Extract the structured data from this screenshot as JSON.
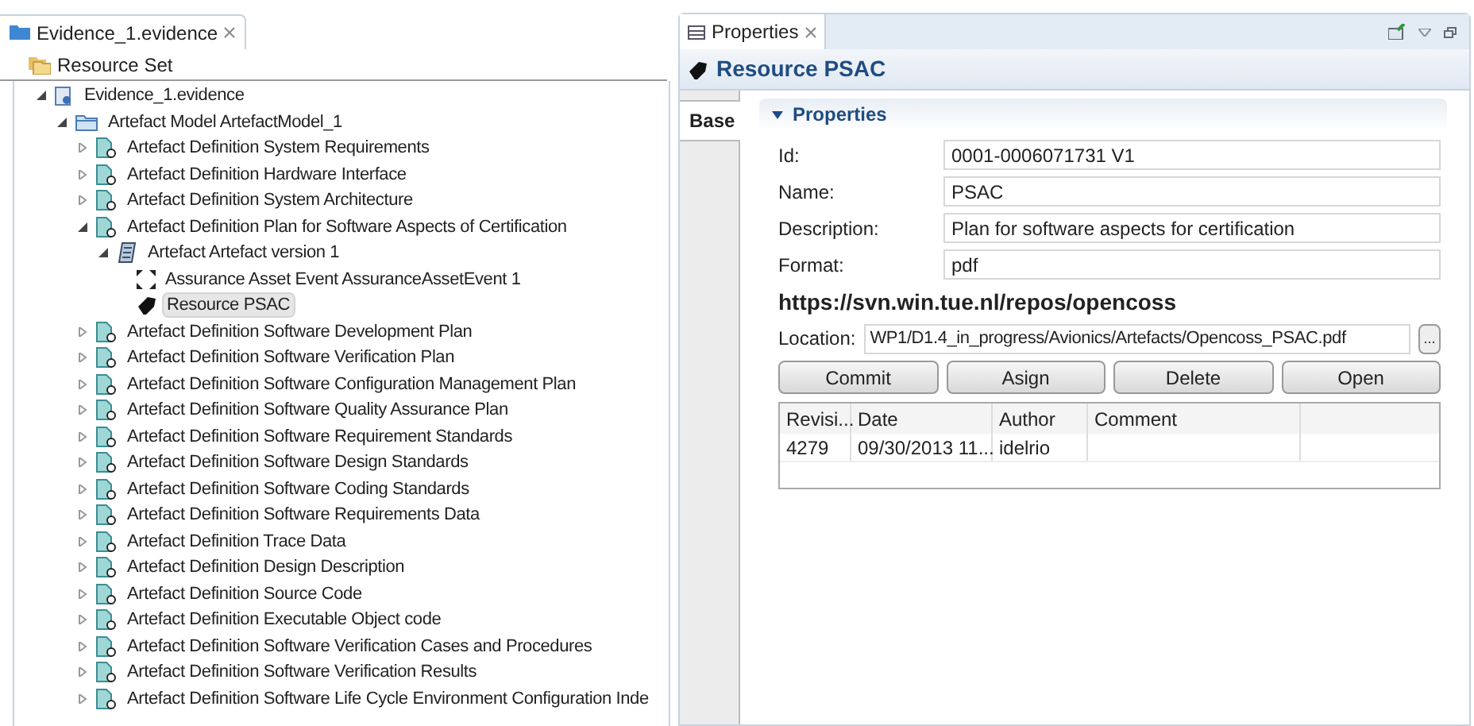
{
  "editor": {
    "tab_title": "Evidence_1.evidence",
    "root_label": "Resource Set"
  },
  "tree": [
    {
      "kind": "file",
      "label": "Evidence_1.evidence",
      "expanded": true,
      "selected": false,
      "children": [
        {
          "kind": "model",
          "label": "Artefact Model ArtefactModel_1",
          "expanded": true,
          "selected": false,
          "children": [
            {
              "kind": "definition",
              "label": "Artefact Definition System Requirements",
              "expanded": false,
              "selected": false
            },
            {
              "kind": "definition",
              "label": "Artefact Definition Hardware Interface",
              "expanded": false,
              "selected": false
            },
            {
              "kind": "definition",
              "label": "Artefact Definition System Architecture",
              "expanded": false,
              "selected": false
            },
            {
              "kind": "definition",
              "label": "Artefact Definition Plan for Software Aspects of Certification",
              "expanded": true,
              "selected": false,
              "children": [
                {
                  "kind": "artefact",
                  "label": "Artefact Artefact version 1",
                  "expanded": true,
                  "selected": false,
                  "children": [
                    {
                      "kind": "event",
                      "label": "Assurance Asset Event AssuranceAssetEvent 1",
                      "selected": false
                    },
                    {
                      "kind": "resource",
                      "label": "Resource PSAC",
                      "selected": true
                    }
                  ]
                }
              ]
            },
            {
              "kind": "definition",
              "label": "Artefact Definition Software Development Plan",
              "expanded": false,
              "selected": false
            },
            {
              "kind": "definition",
              "label": "Artefact Definition Software Verification Plan",
              "expanded": false,
              "selected": false
            },
            {
              "kind": "definition",
              "label": "Artefact Definition Software Configuration Management Plan",
              "expanded": false,
              "selected": false
            },
            {
              "kind": "definition",
              "label": "Artefact Definition Software Quality Assurance Plan",
              "expanded": false,
              "selected": false
            },
            {
              "kind": "definition",
              "label": "Artefact Definition Software Requirement Standards",
              "expanded": false,
              "selected": false
            },
            {
              "kind": "definition",
              "label": "Artefact Definition Software Design Standards",
              "expanded": false,
              "selected": false
            },
            {
              "kind": "definition",
              "label": "Artefact Definition Software Coding Standards",
              "expanded": false,
              "selected": false
            },
            {
              "kind": "definition",
              "label": "Artefact Definition Software Requirements Data",
              "expanded": false,
              "selected": false
            },
            {
              "kind": "definition",
              "label": "Artefact Definition Trace Data",
              "expanded": false,
              "selected": false
            },
            {
              "kind": "definition",
              "label": "Artefact Definition Design Description",
              "expanded": false,
              "selected": false
            },
            {
              "kind": "definition",
              "label": "Artefact Definition Source Code",
              "expanded": false,
              "selected": false
            },
            {
              "kind": "definition",
              "label": "Artefact Definition Executable Object code",
              "expanded": false,
              "selected": false
            },
            {
              "kind": "definition",
              "label": "Artefact Definition Software Verification Cases and Procedures",
              "expanded": false,
              "selected": false
            },
            {
              "kind": "definition",
              "label": "Artefact Definition Software Verification Results",
              "expanded": false,
              "selected": false
            },
            {
              "kind": "definition",
              "label": "Artefact Definition Software Life Cycle Environment Configuration Inde",
              "expanded": false,
              "selected": false
            }
          ]
        }
      ]
    }
  ],
  "properties": {
    "tab_title": "Properties",
    "title": "Resource PSAC",
    "side_tabs": [
      {
        "label": "Base",
        "selected": true
      }
    ],
    "section": {
      "title": "Properties",
      "expanded": true
    },
    "fields": [
      {
        "label": "Id:",
        "value": "0001-0006071731 V1"
      },
      {
        "label": "Name:",
        "value": "PSAC"
      },
      {
        "label": "Description:",
        "value": "Plan for software aspects for certification"
      },
      {
        "label": "Format:",
        "value": "pdf"
      }
    ],
    "repository_url": "https://svn.win.tue.nl/repos/opencoss",
    "location": {
      "label": "Location:",
      "value": "WP1/D1.4_in_progress/Avionics/Artefacts/Opencoss_PSAC.pdf",
      "browse": "..."
    },
    "buttons": [
      "Commit",
      "Asign",
      "Delete",
      "Open"
    ],
    "table": {
      "columns": [
        "Revisi...",
        "Date",
        "Author",
        "Comment"
      ],
      "rows": [
        [
          "4279",
          "09/30/2013 11...",
          "idelrio",
          ""
        ]
      ]
    }
  }
}
